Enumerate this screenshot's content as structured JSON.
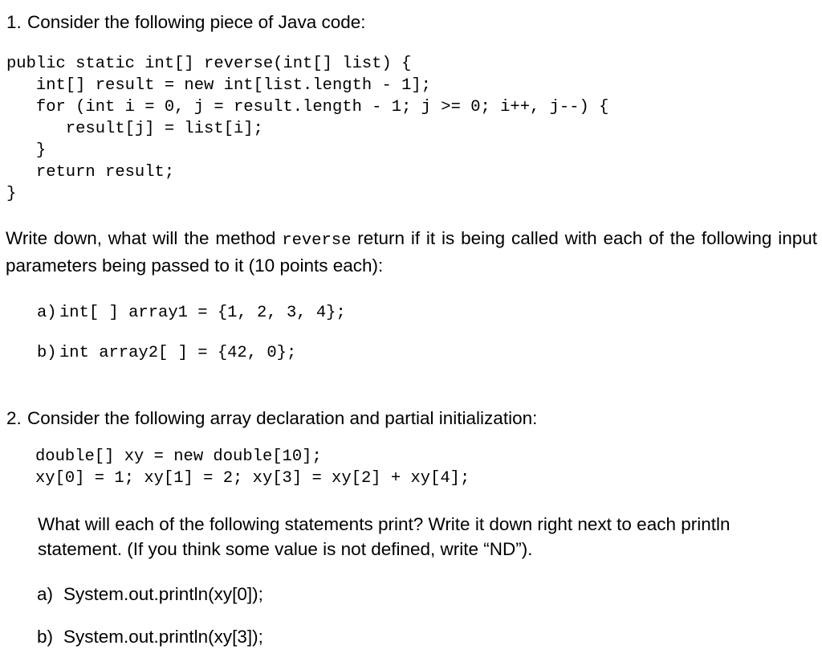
{
  "document": {
    "background_color": "#ffffff",
    "text_color": "#000000"
  },
  "questions": [
    {
      "number": "1.",
      "prompt": "Consider the following piece of Java code:",
      "code": "public static int[] reverse(int[] list) {\n   int[] result = new int[list.length - 1];\n   for (int i = 0, j = result.length - 1; j >= 0; i++, j--) {\n      result[j] = list[i];\n   }\n   return result;\n}",
      "instruction_before_mono": "Write down, what will the method ",
      "instruction_mono": "reverse",
      "instruction_after_mono": " return if it is being called with each of the following input parameters being passed to it (10 points each):",
      "items": [
        {
          "letter": "a)",
          "text": "int[ ] array1 = {1, 2, 3, 4};"
        },
        {
          "letter": "b)",
          "text": "int array2[ ] = {42, 0};"
        }
      ]
    },
    {
      "number": "2.",
      "prompt": "Consider the following array declaration and partial initialization:",
      "code_line_1": "double[] xy = new double[10];",
      "code_line_2": "xy[0] = 1; xy[1] = 2; xy[3] = xy[2] + xy[4];",
      "instruction": "What will each of the following statements print? Write it down right next to each println statement. (If you think some value is not defined, write “ND”).",
      "items": [
        {
          "letter": "a)",
          "text": "System.out.println(xy[0]);"
        },
        {
          "letter": "b)",
          "text": "System.out.println(xy[3]);"
        }
      ]
    }
  ]
}
